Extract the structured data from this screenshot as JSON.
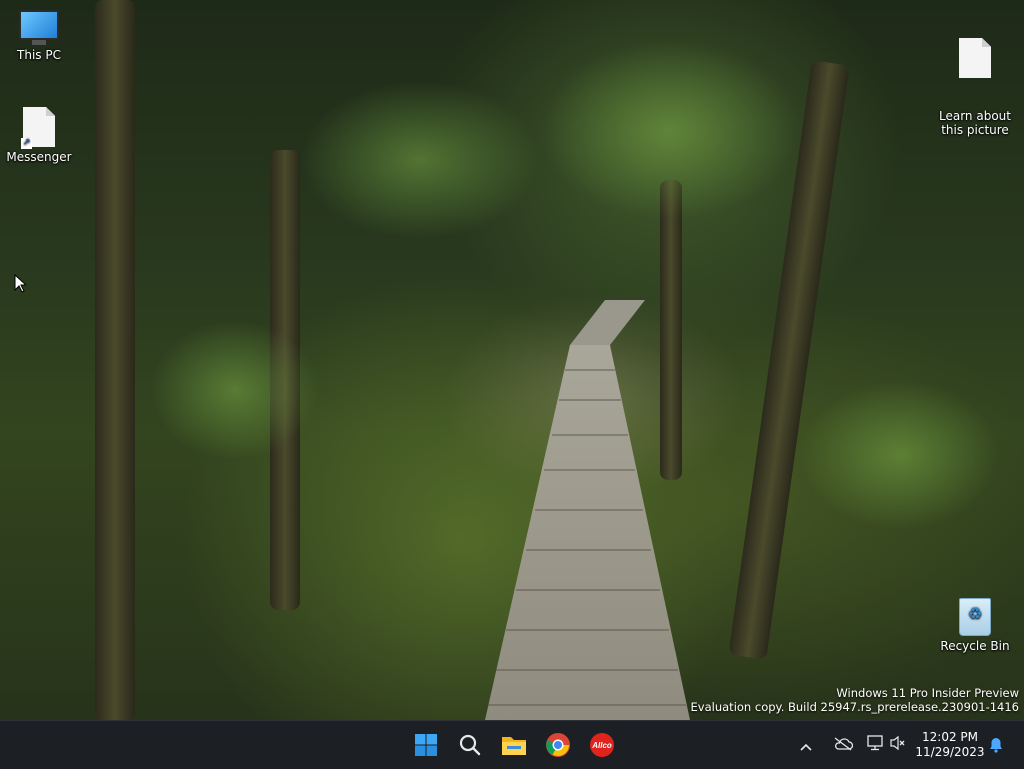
{
  "desktop": {
    "icons": [
      {
        "label": "This PC",
        "icon": "monitor-icon"
      },
      {
        "label": "Messenger",
        "icon": "document-shortcut-icon"
      },
      {
        "label": "Learn about\nthis picture",
        "icon": "document-icon"
      },
      {
        "label": "Recycle Bin",
        "icon": "recycle-bin-icon"
      }
    ],
    "watermark": {
      "line1": "Windows 11 Pro Insider Preview",
      "line2": "Evaluation copy. Build 25947.rs_prerelease.230901-1416"
    }
  },
  "taskbar": {
    "pinned": [
      {
        "name": "start",
        "icon": "windows-logo-icon"
      },
      {
        "name": "search",
        "icon": "search-icon"
      },
      {
        "name": "file-explorer",
        "icon": "folder-icon"
      },
      {
        "name": "chrome",
        "icon": "chrome-icon"
      },
      {
        "name": "allco",
        "icon": "allco-app-icon",
        "text": "Allco"
      }
    ],
    "tray": {
      "time": "12:02 PM",
      "date": "11/29/2023"
    }
  },
  "colors": {
    "taskbar_bg": "#1c1f24",
    "accent": "#0078d4",
    "notification": "#4aa8ff"
  }
}
